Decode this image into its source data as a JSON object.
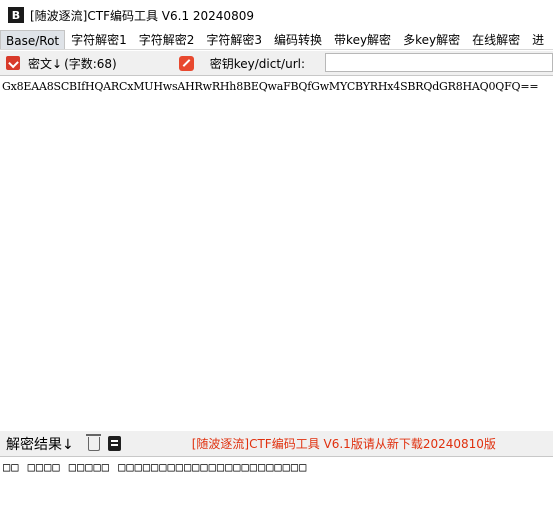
{
  "window": {
    "logo_text": "B",
    "title": "[随波逐流]CTF编码工具 V6.1 20240809"
  },
  "tabs": [
    {
      "label": "Base/Rot",
      "active": true
    },
    {
      "label": "字符解密1",
      "active": false
    },
    {
      "label": "字符解密2",
      "active": false
    },
    {
      "label": "字符解密3",
      "active": false
    },
    {
      "label": "编码转换",
      "active": false
    },
    {
      "label": "带key解密",
      "active": false
    },
    {
      "label": "多key解密",
      "active": false
    },
    {
      "label": "在线解密",
      "active": false
    },
    {
      "label": "进",
      "active": false
    }
  ],
  "keybar": {
    "cipher_label": "密文↓",
    "char_count": "(字数:68)",
    "key_label": "密钥key/dict/url:",
    "key_value": ""
  },
  "cipher": {
    "text": "Gx8EAA8SCBIfHQARCxMUHwsAHRwRHh8BEQwaFBQfGwMYCBYRHx4SBRQdGR8HAQ0QFQ=="
  },
  "result_bar": {
    "label": "解密结果↓",
    "notice": "[随波逐流]CTF编码工具 V6.1版请从新下载20240810版",
    "notice_color": "#e0300e"
  },
  "result": {
    "text": "□□ □□□□ □□□□□ □□□□□□□□□□□□□□□□□□□□□□□"
  }
}
